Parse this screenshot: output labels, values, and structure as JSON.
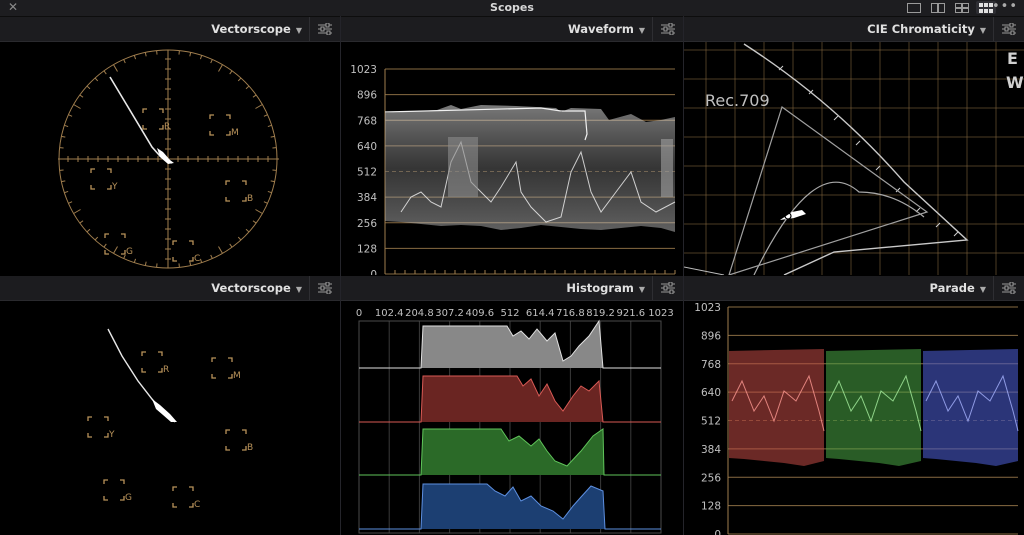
{
  "window": {
    "title": "Scopes",
    "close_icon": "close-icon",
    "more_icon": "more-options-icon"
  },
  "panels": {
    "top_left": {
      "title": "Vectorscope",
      "targets": [
        "R",
        "M",
        "Y",
        "B",
        "G",
        "C"
      ]
    },
    "top_middle": {
      "title": "Waveform",
      "y_labels": [
        "1023",
        "896",
        "768",
        "640",
        "512",
        "384",
        "256",
        "128",
        "0"
      ]
    },
    "top_right": {
      "title": "CIE Chromaticity",
      "gamut_label": "Rec.709",
      "edge_letters": [
        "E",
        "W"
      ]
    },
    "bottom_left": {
      "title": "Vectorscope",
      "targets": [
        "R",
        "M",
        "Y",
        "B",
        "G",
        "C"
      ]
    },
    "bottom_middle": {
      "title": "Histogram",
      "x_labels": [
        "0",
        "102.4",
        "204.8",
        "307.2",
        "409.6",
        "512",
        "614.4",
        "716.8",
        "819.2",
        "921.6",
        "1023"
      ]
    },
    "bottom_right": {
      "title": "Parade",
      "y_labels": [
        "1023",
        "896",
        "768",
        "640",
        "512",
        "384",
        "256",
        "128",
        "0"
      ]
    }
  },
  "colors": {
    "graticule": "#a07e4e",
    "target": "#b8925a",
    "red": "#d95a55",
    "green": "#5fc45a",
    "blue": "#5d6fe0",
    "luma": "#e0e0e0",
    "header": "#1c1c1f"
  }
}
